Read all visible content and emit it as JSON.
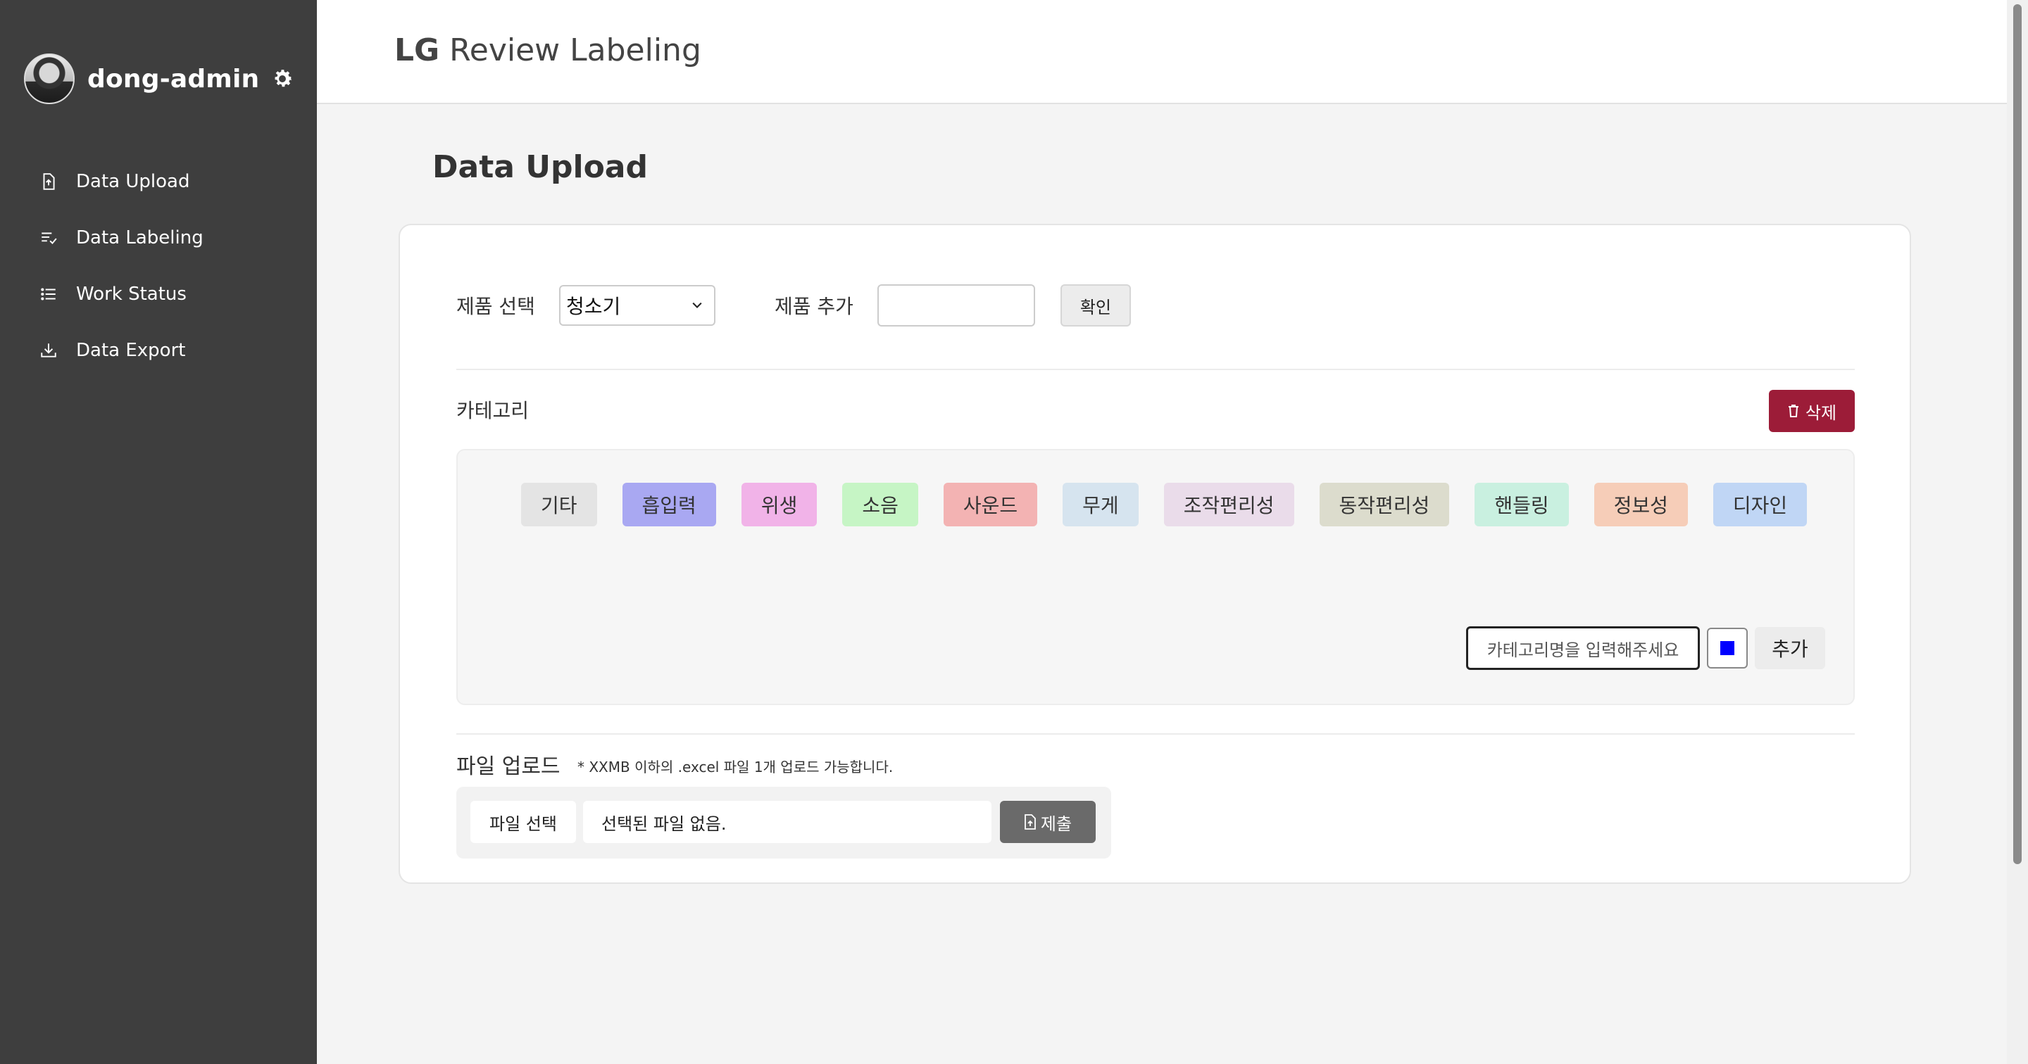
{
  "sidebar": {
    "username": "dong-admin",
    "items": [
      {
        "label": "Data Upload",
        "icon": "file-upload-icon"
      },
      {
        "label": "Data Labeling",
        "icon": "list-check-icon"
      },
      {
        "label": "Work Status",
        "icon": "list-icon"
      },
      {
        "label": "Data Export",
        "icon": "download-icon"
      }
    ]
  },
  "header": {
    "brand": "LG",
    "title": "Review Labeling"
  },
  "main": {
    "page_title": "Data Upload",
    "product_select_label": "제품 선택",
    "product_selected": "청소기",
    "product_add_label": "제품 추가",
    "product_add_value": "",
    "confirm_label": "확인",
    "category_label": "카테고리",
    "delete_label": "삭제",
    "categories": [
      {
        "label": "기타",
        "color": "#e4e4e4"
      },
      {
        "label": "흡입력",
        "color": "#a9a8f2"
      },
      {
        "label": "위생",
        "color": "#f1b3e8"
      },
      {
        "label": "소음",
        "color": "#c6f5c5"
      },
      {
        "label": "사운드",
        "color": "#f3b3b3"
      },
      {
        "label": "무게",
        "color": "#d6e4ef"
      },
      {
        "label": "조작편리성",
        "color": "#eadcea"
      },
      {
        "label": "동작편리성",
        "color": "#dcdccd"
      },
      {
        "label": "핸들링",
        "color": "#c9f0e0"
      },
      {
        "label": "정보성",
        "color": "#f6cdb8"
      },
      {
        "label": "디자인",
        "color": "#c0d6f5"
      }
    ],
    "category_input_placeholder": "카테고리명을 입력해주세요",
    "category_color": "#0000ff",
    "add_label": "추가",
    "upload_label": "파일 업로드",
    "upload_note": "* XXMB 이하의 .excel 파일 1개 업로드 가능합니다.",
    "file_select_label": "파일 선택",
    "file_name": "선택된 파일 없음.",
    "submit_label": "제출"
  },
  "colors": {
    "sidebar_bg": "#3e3e3e",
    "delete_bg": "#9c1c38",
    "submit_bg": "#6a6a6a"
  }
}
